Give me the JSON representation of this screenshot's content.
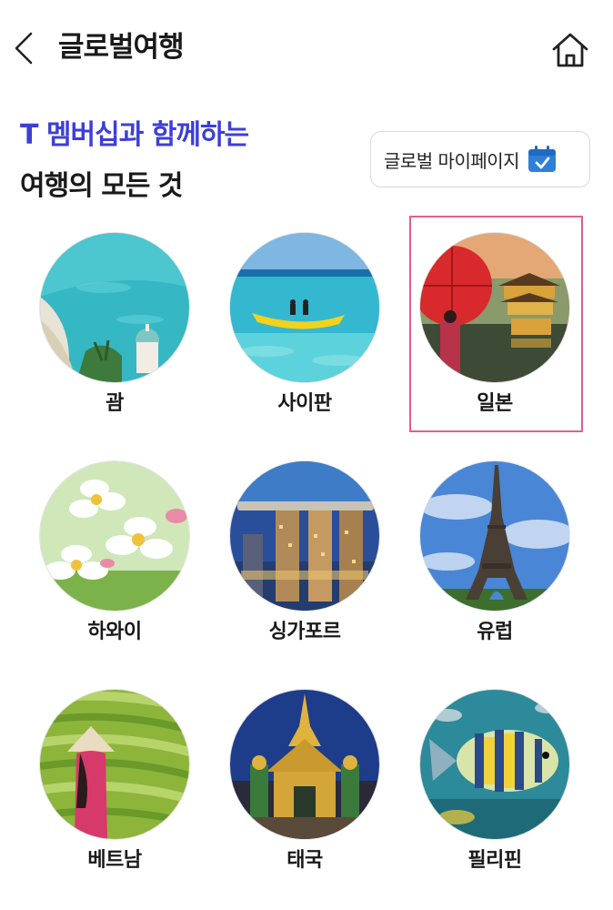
{
  "header": {
    "title": "글로벌여행",
    "back_icon": "chevron-left-icon",
    "home_icon": "home-icon"
  },
  "hero": {
    "line1": "T 멤버십과 함께하는",
    "line2": "여행의 모든 것",
    "accent_color": "#3d3fd8"
  },
  "mypage": {
    "label": "글로벌 마이페이지",
    "icon": "calendar-check-icon",
    "icon_color": "#2f7fd9"
  },
  "destinations": [
    {
      "label": "괌",
      "image": "guam-beach-photo"
    },
    {
      "label": "사이판",
      "image": "saipan-banana-boat-photo"
    },
    {
      "label": "일본",
      "image": "japan-temple-umbrella-photo",
      "highlighted": true
    },
    {
      "label": "하와이",
      "image": "hawaii-plumeria-photo"
    },
    {
      "label": "싱가포르",
      "image": "singapore-marina-bay-photo"
    },
    {
      "label": "유럽",
      "image": "europe-eiffel-tower-photo"
    },
    {
      "label": "베트남",
      "image": "vietnam-rice-terrace-photo"
    },
    {
      "label": "태국",
      "image": "thailand-temple-photo"
    },
    {
      "label": "필리핀",
      "image": "philippines-fish-photo"
    }
  ],
  "highlight_color": "#e0608e"
}
